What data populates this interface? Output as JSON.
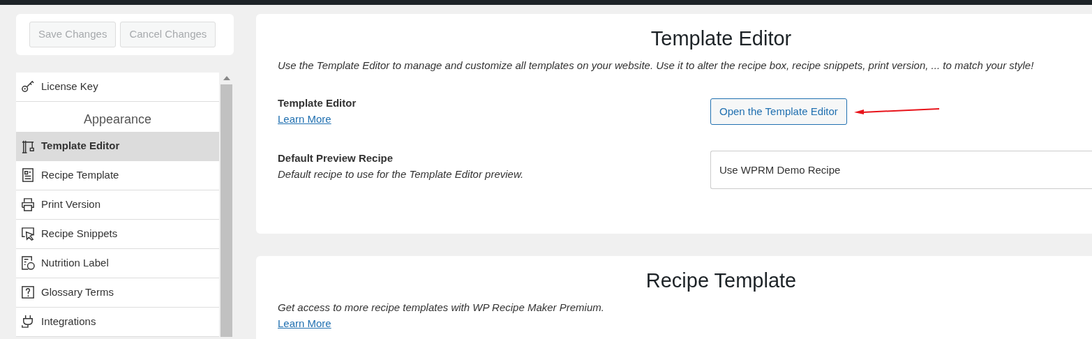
{
  "sidebar": {
    "buttons": [
      {
        "label": "Save Changes",
        "disabled": true
      },
      {
        "label": "Cancel Changes",
        "disabled": true
      }
    ],
    "menu": [
      {
        "kind": "item",
        "label": "License Key",
        "selected": false
      },
      {
        "kind": "header",
        "label": "Appearance"
      },
      {
        "kind": "item",
        "label": "Template Editor",
        "selected": true
      },
      {
        "kind": "item",
        "label": "Recipe Template",
        "selected": false
      },
      {
        "kind": "item",
        "label": "Print Version",
        "selected": false
      },
      {
        "kind": "item",
        "label": "Recipe Snippets",
        "selected": false
      },
      {
        "kind": "item",
        "label": "Nutrition Label",
        "selected": false
      },
      {
        "kind": "item",
        "label": "Glossary Terms",
        "selected": false
      },
      {
        "kind": "item",
        "label": "Integrations",
        "selected": false
      }
    ]
  },
  "sections": [
    {
      "title": "Template Editor",
      "description": "Use the Template Editor to manage and customize all templates on your website. Use it to alter the recipe box, recipe snippets, print version, ... to match your style!",
      "settings": [
        {
          "kind": "button",
          "label": "Template Editor",
          "link": "Learn More",
          "button": "Open the Template Editor"
        },
        {
          "kind": "select",
          "label": "Default Preview Recipe",
          "description": "Default recipe to use for the Template Editor preview.",
          "value": "Use WPRM Demo Recipe"
        }
      ]
    },
    {
      "title": "Recipe Template",
      "description": "Get access to more recipe templates with WP Recipe Maker Premium.",
      "link": "Learn More"
    }
  ]
}
